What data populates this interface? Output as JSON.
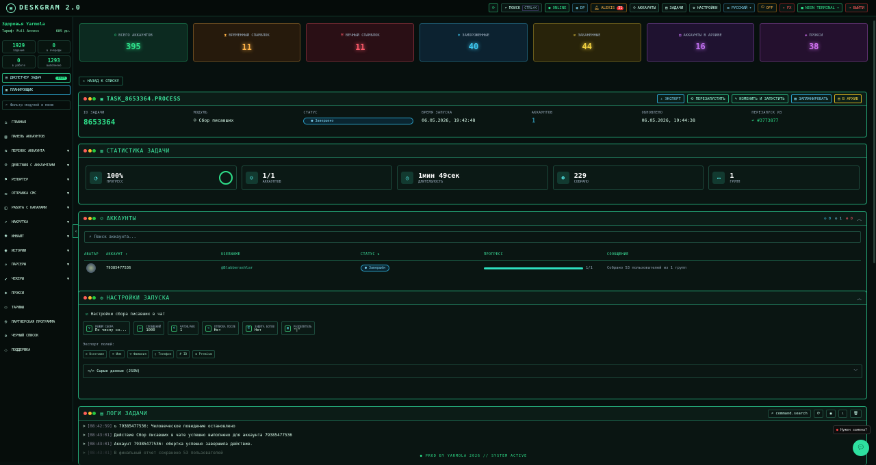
{
  "app": {
    "title": "DESKGRAM 2.0"
  },
  "topbar": {
    "search": "ПОИСК",
    "search_kbd": "CTRL+K",
    "online": "ONLINE",
    "dp": "DP",
    "user": "ALEXIS",
    "user_badge": "31",
    "accounts": "АККАУНТЫ",
    "tasks": "ЗАДАЧИ",
    "settings": "НАСТРОЙКИ",
    "lang": "РУССКИЙ",
    "off": "OFF",
    "fx": "FX",
    "theme": "NEON TERMINAL",
    "logout": "ВЫЙТИ"
  },
  "sidebar": {
    "user": "Здоровья Yarmola",
    "plan": "Тариф: Full Access",
    "days": "685 дн.",
    "stats": [
      {
        "v": "1929",
        "l": "задания"
      },
      {
        "v": "0",
        "l": "в очереди"
      },
      {
        "v": "0",
        "l": "в работе"
      },
      {
        "v": "1293",
        "l": "выполнено"
      }
    ],
    "dispatcher": "ДИСПЕТЧЕР ЗАДАЧ",
    "dispatcher_count": "1929",
    "planner": "ПЛАНИРОВЩИК",
    "filter": "Фильтр модулей и меню",
    "nav": [
      {
        "label": "ГЛАВНАЯ",
        "icon": "⌂",
        "caret": false
      },
      {
        "label": "ПАНЕЛЬ АККАУНТОВ",
        "icon": "▤",
        "caret": false
      },
      {
        "label": "ПЕРЕНОС АККАУНТА",
        "icon": "⇆",
        "caret": true
      },
      {
        "label": "ДЕЙСТВИЯ С АККАУНТАМИ",
        "icon": "☺",
        "caret": true
      },
      {
        "label": "РЕПОРТЕР",
        "icon": "⚑",
        "caret": true
      },
      {
        "label": "ОТПРАВКА СМС",
        "icon": "✉",
        "caret": true
      },
      {
        "label": "РАБОТА С КАНАЛАМИ",
        "icon": "◫",
        "caret": true
      },
      {
        "label": "НАКРУТКА",
        "icon": "↗",
        "caret": true
      },
      {
        "label": "ИНВАЙТ",
        "icon": "☻",
        "caret": true
      },
      {
        "label": "ИСТОРИИ",
        "icon": "◉",
        "caret": true
      },
      {
        "label": "ПАРСЕРЫ",
        "icon": "⌕",
        "caret": true
      },
      {
        "label": "ЧЕКЕРЫ",
        "icon": "✔",
        "caret": true
      },
      {
        "label": "ПРОКСИ",
        "icon": "◈",
        "caret": false
      },
      {
        "label": "ТАРИФЫ",
        "icon": "▭",
        "caret": false
      },
      {
        "label": "ПАРТНЕРСКАЯ ПРОГРАММА",
        "icon": "◎",
        "caret": false
      },
      {
        "label": "ЧЕРНЫЙ СПИСОК",
        "icon": "⊘",
        "caret": false
      },
      {
        "label": "ПОДДЕРЖКА",
        "icon": "◌",
        "caret": false
      }
    ]
  },
  "summary": [
    {
      "label": "ВСЕГО АККАУНТОВ",
      "icon": "☺",
      "value": "395",
      "color": "#2ee08a",
      "bg": "#0c2a20"
    },
    {
      "label": "ВРЕМЕННЫЙ СПАМБЛОК",
      "icon": "⧗",
      "value": "11",
      "color": "#ffb347",
      "bg": "#261a0c"
    },
    {
      "label": "ВЕЧНЫЙ СПАМБЛОК",
      "icon": "⛨",
      "value": "11",
      "color": "#ff5a6a",
      "bg": "#2a0f15"
    },
    {
      "label": "ЗАМОРОЖЕННЫЕ",
      "icon": "❄",
      "value": "40",
      "color": "#3ec8f0",
      "bg": "#0c2230"
    },
    {
      "label": "ЗАБАНЕННЫЕ",
      "icon": "⊘",
      "value": "44",
      "color": "#f0d040",
      "bg": "#28230a"
    },
    {
      "label": "АККАУНТЫ В АРХИВЕ",
      "icon": "▤",
      "value": "16",
      "color": "#c070f0",
      "bg": "#1f1230"
    },
    {
      "label": "ПРОКСИ",
      "icon": "◈",
      "value": "38",
      "color": "#d070f0",
      "bg": "#24102e"
    }
  ],
  "back": "← НАЗАД К СПИСКУ",
  "task": {
    "title": "TASK_8653364.PROCESS",
    "actions": {
      "export": "⇩ ЭКСПОРТ",
      "restart": "⟲ ПЕРЕЗАПУСТИТЬ",
      "edit": "✎ ИЗМЕНИТЬ И ЗАПУСТИТЬ",
      "plan": "▦ ЗАПЛАНИРОВАТЬ",
      "archive": "▤ В АРХИВ"
    },
    "fields": {
      "id_k": "ID ЗАДАЧИ",
      "id": "8653364",
      "module_k": "МОДУЛЬ",
      "module": "☺ Сбор писавших",
      "status_k": "СТАТУС",
      "status": "● Завершено",
      "start_k": "ВРЕМЯ ЗАПУСКА",
      "start": "06.05.2026, 19:42:48",
      "acc_k": "АККАУНТОВ",
      "acc": "1",
      "upd_k": "ОБНОВЛЕНО",
      "upd": "06.05.2026, 19:44:38",
      "restart_k": "ПЕРЕЗАПУСК ИЗ",
      "restart_v": "↩ #3773877"
    }
  },
  "stats_card": {
    "title": "СТАТИСТИКА ЗАДАЧИ",
    "items": [
      {
        "v": "100%",
        "l": "ПРОГРЕСС",
        "icon": "◔"
      },
      {
        "v": "1/1",
        "l": "АККАУНТОВ",
        "icon": "☺"
      },
      {
        "v": "1мин 49сек",
        "l": "ДЛИТЕЛЬНОСТЬ",
        "icon": "◷"
      },
      {
        "v": "229",
        "l": "СОБРАНО",
        "icon": "☻"
      },
      {
        "v": "1",
        "l": "ГРУПП",
        "icon": "▭"
      }
    ],
    "progress": 1.0
  },
  "accounts_card": {
    "title": "АККАУНТЫ",
    "counts": [
      "⊙ 0",
      "⊙ 1",
      "⊗ 0"
    ],
    "search": "Поиск аккаунта...",
    "headers": [
      "АВАТАР",
      "АККАУНТ ↑",
      "USERNAME",
      "СТАТУС ⇅",
      "ПРОГРЕСС",
      "СООБЩЕНИЕ"
    ],
    "row": {
      "account": "79385477536",
      "username": "@Blabberashlar",
      "status": "● Завершён",
      "progress_text": "1/1",
      "progress": 1.0,
      "message": "Собрано 53 пользователей из 1 групп"
    }
  },
  "settings_card": {
    "title": "НАСТРОЙКИ ЗАПУСКА",
    "subtitle": "Настройки сбора писавших в чат",
    "params": [
      {
        "k": "РЕЖИМ СБОРА",
        "v": "По числу со...",
        "i": "▽"
      },
      {
        "k": "СООБЩЕНИЙ",
        "v": "1000",
        "i": "▭"
      },
      {
        "k": "ЧАТОВ/АКК",
        "v": "1",
        "i": "☺"
      },
      {
        "k": "ОТПИСКА ПОСЛЕ",
        "v": "Нет",
        "i": "⇥"
      },
      {
        "k": "ЗАЩИТА БОТОВ",
        "v": "Нет",
        "i": "⛨"
      },
      {
        "k": "РАЗДЕЛИТЕЛЬ",
        "v": "\"|\"",
        "i": "▥"
      }
    ],
    "export_label": "Экспорт полей:",
    "export_fields": [
      "⊙ Username",
      "☺ Имя",
      "☺ Фамилия",
      "▯ Телефон",
      "# ID",
      "♛ Premium"
    ],
    "json": "</> Сырые данные (JSON)"
  },
  "logs_card": {
    "title": "ЛОГИ ЗАДАЧИ",
    "search": "⌕ command.search",
    "lines": [
      {
        "t": "[08:42:59]",
        "m": "↻ 79385477536: Человеческое поведение остановлено"
      },
      {
        "t": "[08:43:01]",
        "m": "Действие Сбор писавших в чате успешно выполнено для аккаунта 79385477536"
      },
      {
        "t": "[08:43:01]",
        "m": "Аккаунт 79385477536: обертка успешно завершила действие."
      },
      {
        "t": "[08:43:01]",
        "m": "В финальный отчет сохранено 53 пользователей"
      }
    ]
  },
  "footer": "● PROD BY YARMOLA 2026   // SYSTEM ACTIVE",
  "help": "Нужен замена?"
}
